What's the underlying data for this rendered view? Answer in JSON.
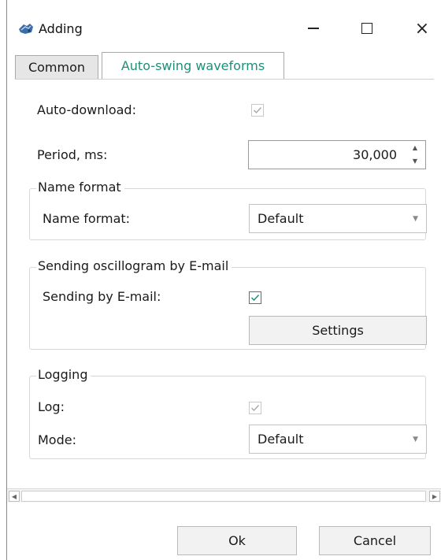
{
  "window": {
    "title": "Adding",
    "icon": "app-icon",
    "controls": [
      "minimize-icon",
      "maximize-icon",
      "close-icon"
    ],
    "close_glyph": "×"
  },
  "tabs": [
    {
      "label": "Common",
      "active": false
    },
    {
      "label": "Auto-swing waveforms",
      "active": true
    }
  ],
  "form": {
    "auto_download": {
      "label": "Auto-download:",
      "checked": true,
      "enabled": false
    },
    "period": {
      "label": "Period, ms:",
      "value": "30,000",
      "up": "▲",
      "down": "▼"
    },
    "name_format_group": {
      "title": "Name format",
      "label": "Name format:",
      "selected": "Default",
      "arrow": "▼"
    },
    "email_group": {
      "title": "Sending oscillogram by E-mail",
      "label": "Sending by E-mail:",
      "checked": true,
      "enabled": true,
      "settings_button": "Settings"
    },
    "logging_group": {
      "title": "Logging",
      "log_label": "Log:",
      "log_checked": true,
      "log_enabled": false,
      "mode_label": "Mode:",
      "mode_selected": "Default",
      "arrow": "▼"
    }
  },
  "scrollbar": {
    "left": "◀",
    "right": "▶"
  },
  "footer": {
    "ok": "Ok",
    "cancel": "Cancel"
  },
  "colors": {
    "active_tab_text": "#1f8f7a",
    "check_enabled": "#1f8f7a",
    "check_disabled": "#a8a8a8"
  }
}
